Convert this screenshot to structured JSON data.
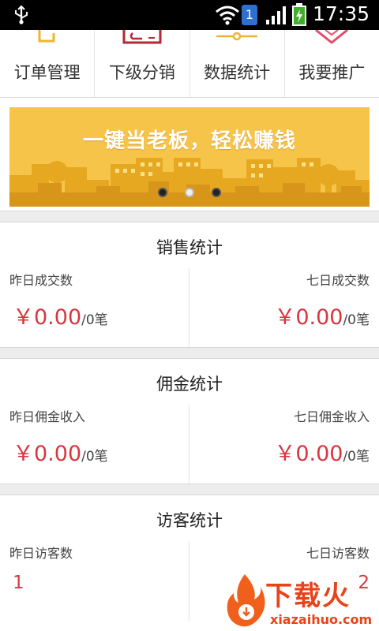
{
  "status_bar": {
    "time": "17:35",
    "sim_number": "1",
    "icons": [
      "usb-icon",
      "wifi-icon",
      "sim-icon",
      "signal-icon",
      "battery-icon"
    ]
  },
  "nav": {
    "items": [
      {
        "label": "订单管理",
        "icon": "order-icon"
      },
      {
        "label": "下级分销",
        "icon": "distribution-icon"
      },
      {
        "label": "数据统计",
        "icon": "statistics-icon"
      },
      {
        "label": "我要推广",
        "icon": "promote-icon"
      }
    ]
  },
  "banner": {
    "text": "一键当老板，轻松赚钱",
    "dots": 3,
    "active_dot": 2
  },
  "sales": {
    "title": "销售统计",
    "left_label": "昨日成交数",
    "left_amount": "￥0.00",
    "left_count": "/0笔",
    "right_label": "七日成交数",
    "right_amount": "￥0.00",
    "right_count": "/0笔"
  },
  "commission": {
    "title": "佣金统计",
    "left_label": "昨日佣金收入",
    "left_amount": "￥0.00",
    "left_count": "/0笔",
    "right_label": "七日佣金收入",
    "right_amount": "￥0.00",
    "right_count": "/0笔"
  },
  "visitors": {
    "title": "访客统计",
    "left_label": "昨日访客数",
    "left_value": "1",
    "right_label": "七日访客数",
    "right_value": "2"
  },
  "watermark": {
    "text": "下载火",
    "sub": "xiazaihuo.com"
  },
  "colors": {
    "accent_red": "#d9363e",
    "banner_yellow": "#f7c44a",
    "watermark_orange": "#e8431a"
  }
}
